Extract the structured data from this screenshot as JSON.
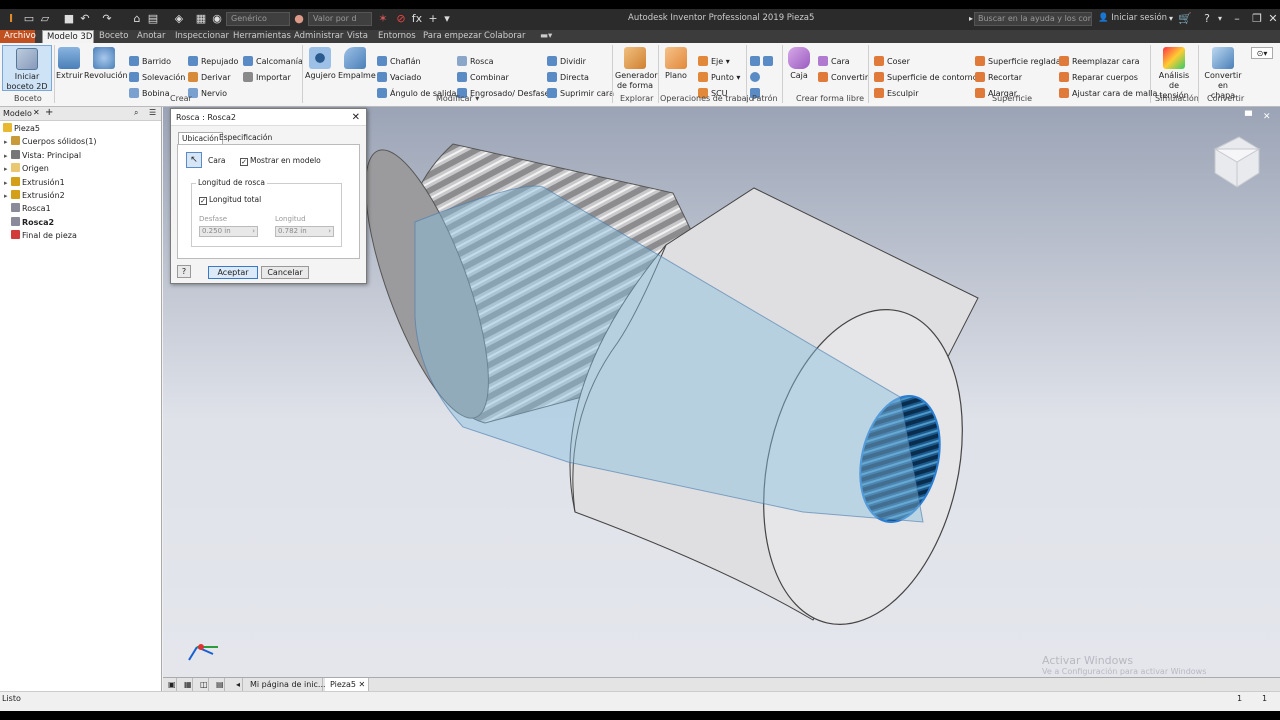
{
  "titlebar": {
    "material": "Genérico",
    "appearance": "Valor por d",
    "title": "Autodesk Inventor Professional 2019   Pieza5",
    "search_placeholder": "Buscar en la ayuda y los comandos",
    "signin": "Iniciar sesión"
  },
  "tabs": [
    "Archivo",
    "Modelo 3D",
    "Boceto",
    "Anotar",
    "Inspeccionar",
    "Herramientas",
    "Administrar",
    "Vista",
    "Entornos",
    "Para empezar",
    "Colaborar"
  ],
  "ribbon": {
    "boceto": {
      "start_line1": "Iniciar",
      "start_line2": "boceto 2D",
      "label": "Boceto"
    },
    "crear": {
      "extruir": "Extruir",
      "revolucion": "Revolución",
      "barrido": "Barrido",
      "solevacion": "Solevación",
      "bobina": "Bobina",
      "repujado": "Repujado",
      "derivar": "Derivar",
      "nervio": "Nervio",
      "calcomania": "Calcomanía",
      "importar": "Importar",
      "label": "Crear"
    },
    "modificar": {
      "agujero": "Agujero",
      "empalme": "Empalme",
      "chaflan": "Chaflán",
      "vaciado": "Vaciado",
      "angulo": "Ángulo de salida",
      "rosca": "Rosca",
      "combinar": "Combinar",
      "engrosado": "Engrosado/ Desfase",
      "dividir": "Dividir",
      "directa": "Directa",
      "suprimir": "Suprimir cara",
      "label": "Modificar"
    },
    "explorar": {
      "gen_line1": "Generador",
      "gen_line2": "de forma",
      "label": "Explorar"
    },
    "trabajo": {
      "plano": "Plano",
      "eje": "Eje",
      "punto": "Punto",
      "scu": "SCU",
      "label": "Operaciones de trabajo"
    },
    "patron": {
      "label": "Patrón"
    },
    "forma_libre": {
      "caja": "Caja",
      "cara": "Cara",
      "convertir": "Convertir",
      "label": "Crear forma libre"
    },
    "superficie": {
      "coser": "Coser",
      "sup_contorno": "Superficie de contorno",
      "esculpir": "Esculpir",
      "sup_reglada": "Superficie reglada",
      "recortar": "Recortar",
      "alargar": "Alargar",
      "reemplazar": "Reemplazar cara",
      "reparar": "Reparar cuerpos",
      "ajustar": "Ajustar cara de malla",
      "label": "Superficie"
    },
    "simulacion": {
      "line1": "Análisis",
      "line2": "de tensión",
      "label": "Simulación"
    },
    "convertir": {
      "line1": "Convertir en",
      "line2": "chapa",
      "label": "Convertir"
    }
  },
  "browser": {
    "tab": "Modelo",
    "items": [
      {
        "label": "Pieza5",
        "level": 0,
        "color": "#e8b830"
      },
      {
        "label": "Cuerpos sólidos(1)",
        "level": 1,
        "color": "#c99a3a"
      },
      {
        "label": "Vista: Principal",
        "level": 1,
        "color": "#777777"
      },
      {
        "label": "Origen",
        "level": 1,
        "color": "#e8c870"
      },
      {
        "label": "Extrusión1",
        "level": 1,
        "color": "#d4a017"
      },
      {
        "label": "Extrusión2",
        "level": 1,
        "color": "#d4a017"
      },
      {
        "label": "Rosca1",
        "level": 1,
        "color": "#8a8a9a"
      },
      {
        "label": "Rosca2",
        "level": 1,
        "color": "#8a8a9a"
      },
      {
        "label": "Final de pieza",
        "level": 1,
        "color": "#d23b3b"
      }
    ]
  },
  "dialog": {
    "title": "Rosca : Rosca2",
    "tab_location": "Ubicación",
    "tab_spec": "Especificación",
    "face_label": "Cara",
    "show_in_model": "Mostrar en modelo",
    "group_label": "Longitud de rosca",
    "full_length": "Longitud total",
    "offset_label": "Desfase",
    "offset_value": "0.250 in",
    "length_label": "Longitud",
    "length_value": "0.782 in",
    "ok": "Aceptar",
    "cancel": "Cancelar"
  },
  "doc_tabs": [
    "Mi página de inic...",
    "Pieza5"
  ],
  "status": {
    "left": "Listo",
    "count1": "1",
    "count2": "1"
  },
  "watermark": {
    "line1": "Activar Windows",
    "line2": "Ve a Configuración para activar Windows"
  }
}
